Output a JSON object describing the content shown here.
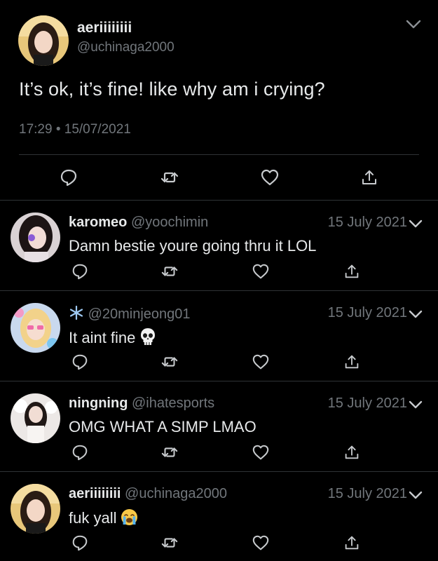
{
  "main_tweet": {
    "display_name": "aeriiiiiiii",
    "handle": "@uchinaga2000",
    "text": "It’s ok, it’s fine! like why am i crying?",
    "timestamp": "17:29 • 15/07/2021",
    "icons": [
      "reply-icon",
      "retweet-icon",
      "like-icon",
      "share-icon",
      "chevron-down-icon"
    ]
  },
  "replies": [
    {
      "display_name": "karomeo",
      "handle": "@yoochimin",
      "date": "15 July 2021",
      "text": "Damn bestie youre going thru it LOL",
      "emoji": ""
    },
    {
      "display_name": "❄️",
      "handle": "@20minjeong01",
      "date": "15 July 2021",
      "text": "It aint fine",
      "emoji": "skull-emoji"
    },
    {
      "display_name": "ningning",
      "handle": "@ihatesports",
      "date": "15 July 2021",
      "text": "OMG WHAT A SIMP LMAO",
      "emoji": ""
    },
    {
      "display_name": "aeriiiiiiii",
      "handle": "@uchinaga2000",
      "date": "15 July 2021",
      "text": "fuk yall",
      "emoji": "loudly-crying-emoji"
    }
  ],
  "colors": {
    "background": "#000000",
    "text": "#e7e9ea",
    "secondary": "#71767b",
    "divider": "#2f3336"
  }
}
